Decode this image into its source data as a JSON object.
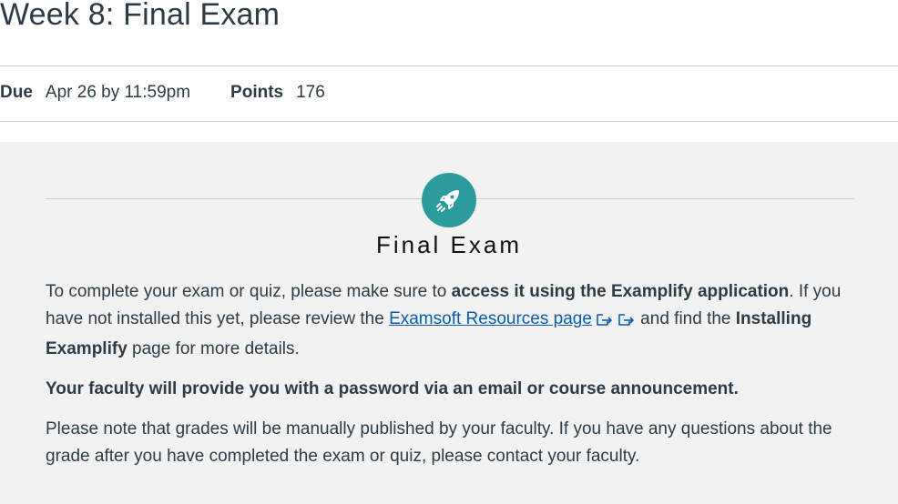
{
  "page": {
    "title": "Week 8: Final Exam"
  },
  "meta": {
    "due_label": "Due",
    "due_value": "Apr 26 by 11:59pm",
    "points_label": "Points",
    "points_value": "176"
  },
  "banner": {
    "icon": "rocket-icon",
    "accent_color": "#2b9b9e",
    "heading": "Final Exam"
  },
  "instructions": {
    "p1_a": "To complete your exam or quiz, please make sure to ",
    "p1_b": "access it using the Examplify application",
    "p1_c": ". If you have not installed this yet, please review the ",
    "p1_link": "Examsoft Resources page",
    "p1_d": " and find the ",
    "p1_e": "Installing Examplify",
    "p1_f": " page for more details.",
    "p2": "Your faculty will provide you with a password via an email or course announcement.",
    "p3": "Please note that grades will be manually published by your faculty. If you have any questions about the grade after you have completed the exam or quiz, please contact your faculty."
  }
}
